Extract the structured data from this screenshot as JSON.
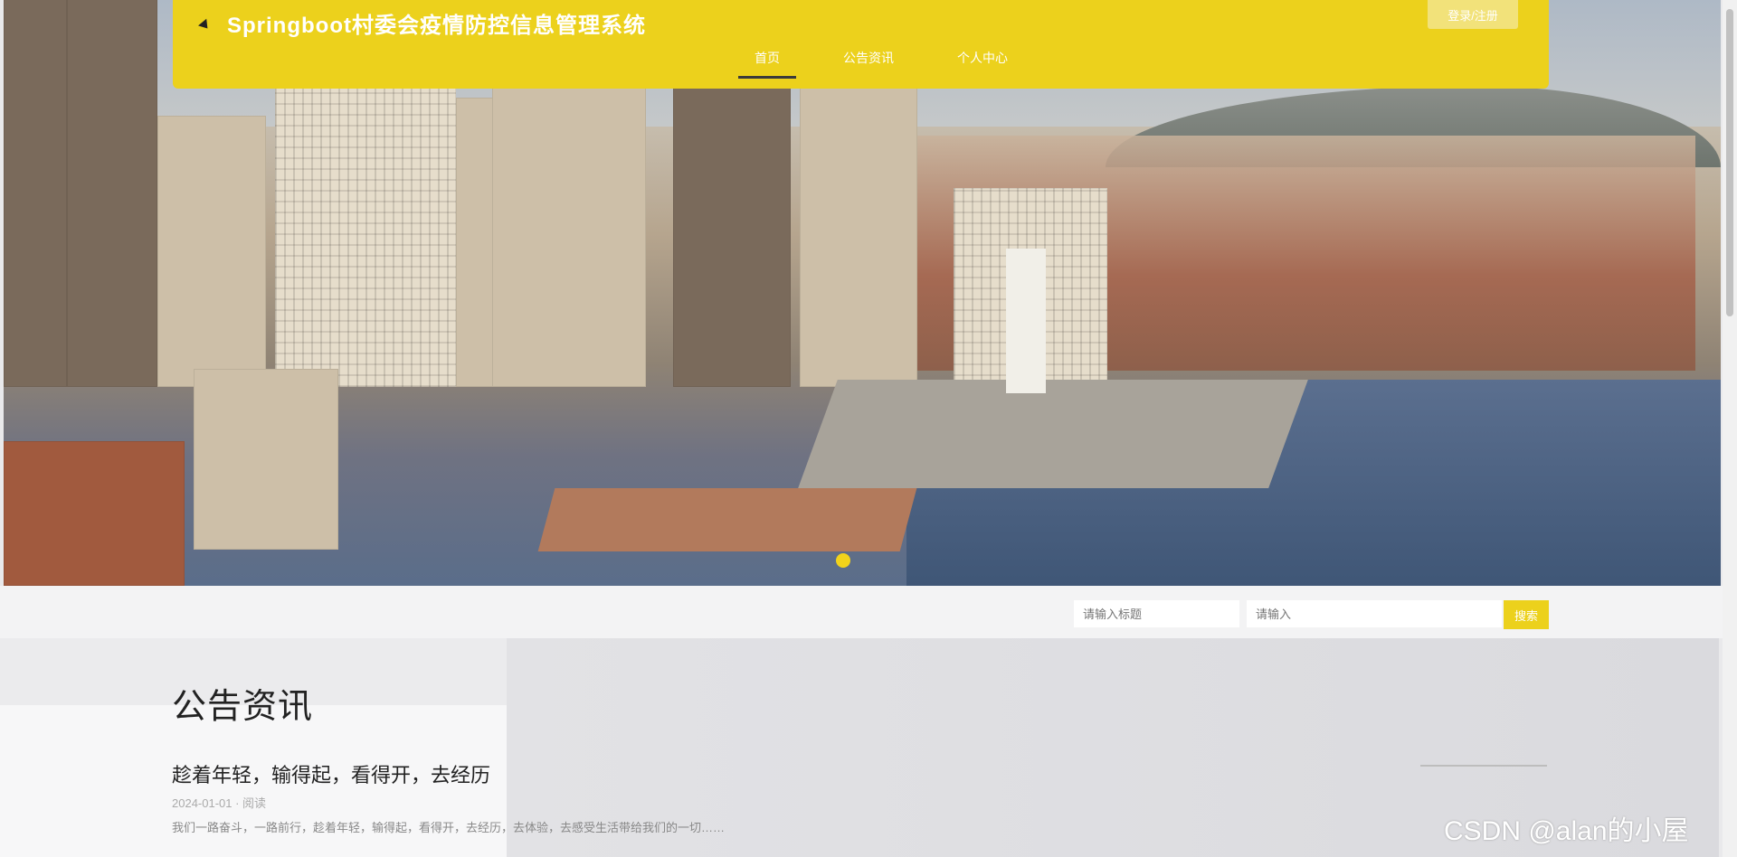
{
  "header": {
    "site_title": "Springboot村委会疫情防控信息管理系统",
    "login_label": "登录/注册",
    "nav": [
      {
        "label": "首页",
        "active": true
      },
      {
        "label": "公告资讯",
        "active": false
      },
      {
        "label": "个人中心",
        "active": false
      }
    ],
    "accent_color": "#ecd11c"
  },
  "search": {
    "title_placeholder": "请输入标题",
    "keyword_placeholder": "请输入",
    "button_label": "搜索"
  },
  "news": {
    "section_title": "公告资讯",
    "article_title": "趁着年轻，输得起，看得开，去经历",
    "article_meta": "2024-01-01 · 阅读",
    "article_body": "我们一路奋斗，一路前行，趁着年轻，输得起，看得开，去经历，去体验，去感受生活带给我们的一切……",
    "watermark": "CSDN @alan的小屋"
  },
  "icons": {
    "cursor": "cursor-icon",
    "carousel": "carousel-indicator-icon"
  }
}
